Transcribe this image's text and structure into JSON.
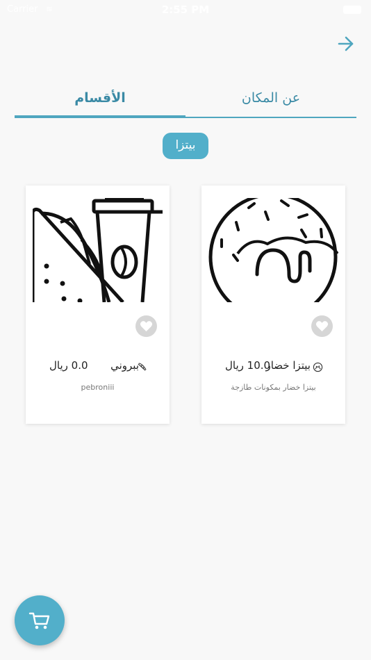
{
  "status_bar": {
    "carrier": "Carrier",
    "wifi": "wifi",
    "time": "2:55 PM",
    "battery": "battery"
  },
  "header": {
    "back_icon": "arrow-right-icon"
  },
  "tabs": [
    {
      "label": "عن المكان",
      "active": false
    },
    {
      "label": "الأقسام",
      "active": true
    }
  ],
  "category": {
    "label": "بيتزا"
  },
  "products": [
    {
      "name": "بيتزا خضار",
      "price": "10.0 ريال",
      "description": "بيتزا خضار بمكونات طازجة",
      "image": "donut-icon",
      "favorite": false
    },
    {
      "name": "ببروني",
      "price": "0.0 ريال",
      "description": "pebroniii",
      "image": "sandwich-coffee-icon",
      "favorite": false
    }
  ],
  "cart": {
    "icon": "cart-icon"
  },
  "colors": {
    "accent": "#52afca",
    "tab_text": "#3a8aa5",
    "background": "#f8f8f8"
  }
}
